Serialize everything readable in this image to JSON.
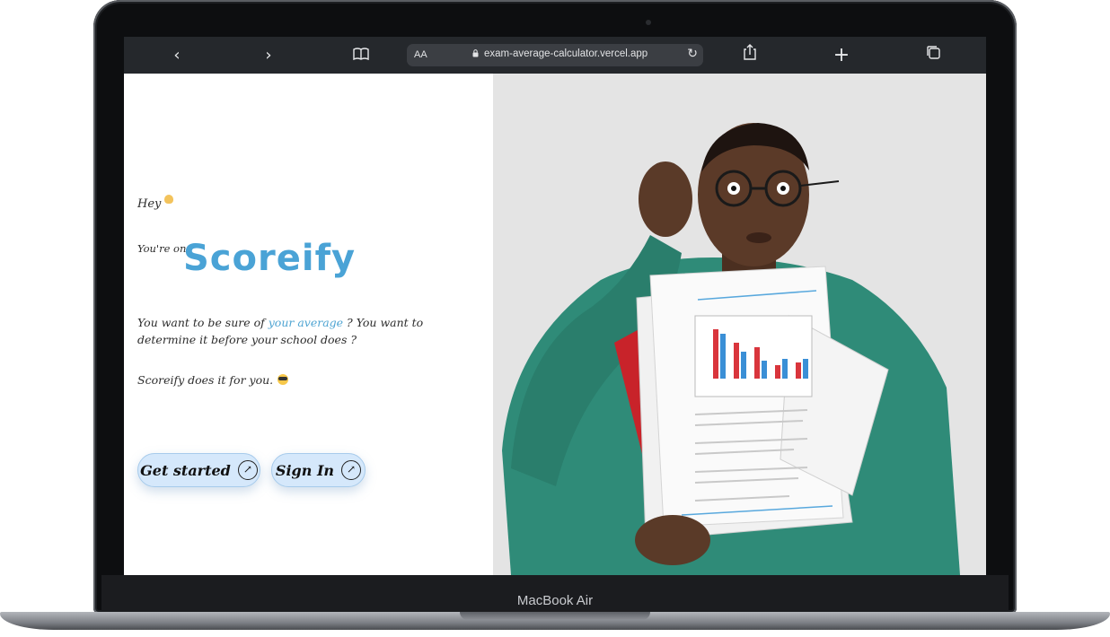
{
  "device": {
    "model_label": "MacBook Air"
  },
  "browser": {
    "address_bar": {
      "text_size_label": "AA",
      "url": "exam-average-calculator.vercel.app"
    },
    "icons": [
      "back-icon",
      "forward-icon",
      "bookmarks-icon",
      "reload-icon",
      "share-icon",
      "new-tab-icon",
      "tabs-icon"
    ]
  },
  "page": {
    "greeting": "Hey",
    "youre_on": "You're on",
    "brand": "Scoreify",
    "para1_prefix": "You want to be sure of ",
    "para1_highlight": "your average",
    "para1_suffix": " ? You want to determine it before your school does ?",
    "para2": "Scoreify does it for you.",
    "buttons": {
      "get_started": "Get started",
      "sign_in": "Sign In"
    }
  },
  "colors": {
    "brand": "#4aa3d6",
    "button_bg": "#d5e8fb",
    "toolbar": "#25282c",
    "sweater": "#2f8b78"
  }
}
